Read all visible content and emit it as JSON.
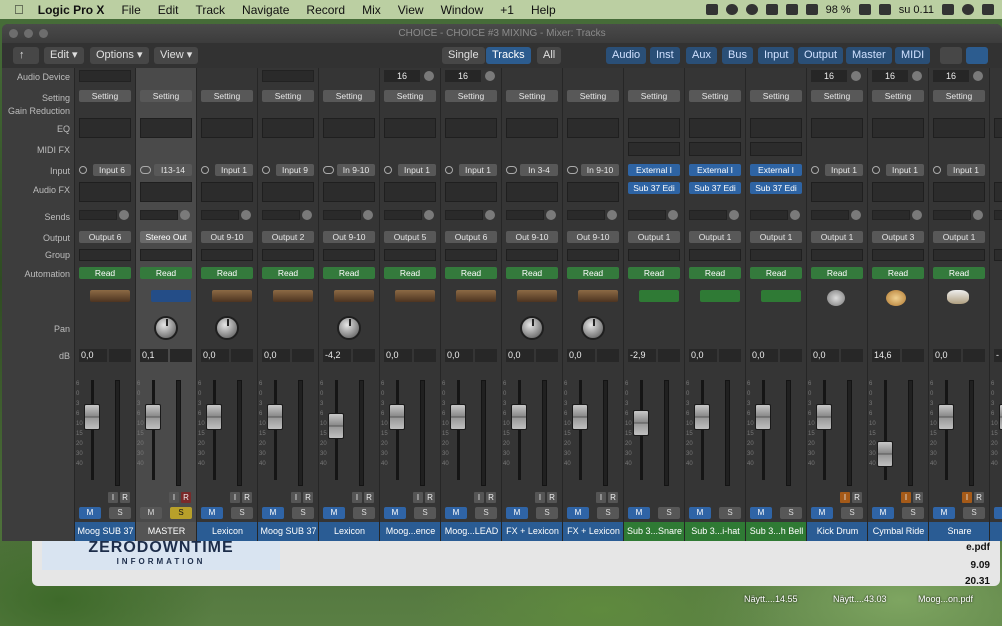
{
  "menubar": {
    "app": "Logic Pro X",
    "items": [
      "File",
      "Edit",
      "Track",
      "Navigate",
      "Record",
      "Mix",
      "View",
      "Window",
      "+1",
      "Help"
    ],
    "battery": "98 %",
    "time": "su 0.11"
  },
  "window": {
    "title": "CHOICE - CHOICE #3 MIXING - Mixer: Tracks"
  },
  "toolbar": {
    "edit": "Edit",
    "options": "Options",
    "view": "View",
    "single": "Single",
    "tracks": "Tracks",
    "all": "All",
    "filters": [
      "Audio",
      "Inst",
      "Aux",
      "Bus",
      "Input",
      "Output",
      "Master",
      "MIDI"
    ]
  },
  "labels": {
    "audio_device": "Audio Device",
    "setting": "Setting",
    "gain_reduction": "Gain Reduction",
    "eq": "EQ",
    "midi_fx": "MIDI FX",
    "input": "Input",
    "audio_fx": "Audio FX",
    "sends": "Sends",
    "output": "Output",
    "group": "Group",
    "automation": "Automation",
    "pan": "Pan",
    "db": "dB"
  },
  "strips": [
    {
      "name": "Moog SUB 37",
      "kind": "audio",
      "setting": "Setting",
      "input": "Input 6",
      "output": "Output 6",
      "automation": "Read",
      "db": "0,0",
      "fader_level": 0.78,
      "device": "",
      "instr": "kbd"
    },
    {
      "name": "MASTER",
      "kind": "master",
      "setting": "Setting",
      "input": "I13-14",
      "output": "Stereo Out",
      "automation": "Read",
      "db": "0,1",
      "fader_level": 0.78,
      "device": "",
      "instr": "bars"
    },
    {
      "name": "Lexicon",
      "kind": "audio",
      "setting": "Setting",
      "input": "Input 1",
      "output": "Out 9-10",
      "automation": "Read",
      "db": "0,0",
      "fader_level": 0.78,
      "device": "",
      "instr": "kbd2"
    },
    {
      "name": "Moog SUB 37",
      "kind": "audio",
      "setting": "Setting",
      "input": "Input 9",
      "output": "Output 2",
      "automation": "Read",
      "db": "0,0",
      "fader_level": 0.78,
      "device": "",
      "instr": "kbd"
    },
    {
      "name": "Lexicon",
      "kind": "audio",
      "setting": "Setting",
      "input": "In 9-10",
      "output": "Out 9-10",
      "automation": "Read",
      "db": "-4,2",
      "fader_level": 0.66,
      "device": "",
      "instr": "kbd2"
    },
    {
      "name": "Moog...ence",
      "kind": "audio",
      "setting": "Setting",
      "input": "Input 1",
      "output": "Output 5",
      "automation": "Read",
      "db": "0,0",
      "fader_level": 0.78,
      "device": "16",
      "instr": "kbd"
    },
    {
      "name": "Moog...LEAD",
      "kind": "audio",
      "setting": "Setting",
      "input": "Input 1",
      "output": "Output 6",
      "automation": "Read",
      "db": "0,0",
      "fader_level": 0.78,
      "device": "16",
      "instr": "kbd"
    },
    {
      "name": "FX + Lexicon",
      "kind": "audio",
      "setting": "Setting",
      "input": "In 3-4",
      "output": "Out 9-10",
      "automation": "Read",
      "db": "0,0",
      "fader_level": 0.78,
      "device": "",
      "instr": "kbd2"
    },
    {
      "name": "FX + Lexicon",
      "kind": "audio",
      "setting": "Setting",
      "input": "In 9-10",
      "output": "Out 9-10",
      "automation": "Read",
      "db": "0,0",
      "fader_level": 0.78,
      "device": "",
      "instr": "kbd2"
    },
    {
      "name": "Sub 3...Snare",
      "kind": "inst",
      "setting": "Setting",
      "input": "External I",
      "fx": "Sub 37 Edi",
      "output": "Output 1",
      "automation": "Read",
      "db": "-2,9",
      "fader_level": 0.7,
      "device": "",
      "instr": "note"
    },
    {
      "name": "Sub 3...i-hat",
      "kind": "inst",
      "setting": "Setting",
      "input": "External I",
      "fx": "Sub 37 Edi",
      "output": "Output 1",
      "automation": "Read",
      "db": "0,0",
      "fader_level": 0.78,
      "device": "",
      "instr": "note"
    },
    {
      "name": "Sub 3...h Bell",
      "kind": "inst",
      "setting": "Setting",
      "input": "External I",
      "fx": "Sub 37 Edi",
      "output": "Output 1",
      "automation": "Read",
      "db": "0,0",
      "fader_level": 0.78,
      "device": "",
      "instr": "note"
    },
    {
      "name": "Kick Drum",
      "kind": "audio",
      "setting": "Setting",
      "input": "Input 1",
      "output": "Output 1",
      "automation": "Read",
      "db": "0,0",
      "fader_level": 0.78,
      "device": "16",
      "instr": "kick"
    },
    {
      "name": "Cymbal Ride",
      "kind": "audio",
      "setting": "Setting",
      "input": "Input 1",
      "output": "Output 3",
      "automation": "Read",
      "db": "14,6",
      "fader_level": 0.28,
      "device": "16",
      "instr": "cym"
    },
    {
      "name": "Snare",
      "kind": "audio",
      "setting": "Setting",
      "input": "Input 1",
      "output": "Output 1",
      "automation": "Read",
      "db": "0,0",
      "fader_level": 0.78,
      "device": "16",
      "instr": "snare"
    },
    {
      "name": "Sn",
      "kind": "audio",
      "setting": "",
      "input": "",
      "output": "",
      "automation": "",
      "db": "-",
      "fader_level": 0.78,
      "device": "",
      "instr": ""
    }
  ],
  "background": {
    "logo_line1": "ZERODOWNTIME",
    "logo_line2": "INFORMATION",
    "file1": "e.pdf",
    "file2": "9.09",
    "file3": "20.31",
    "dock": [
      "Näytt....14.55",
      "Näytt....43.03",
      "Moog...on.pdf"
    ]
  },
  "colors": {
    "blue": "#2e64a4",
    "green": "#347a3c",
    "master": "#545454"
  }
}
